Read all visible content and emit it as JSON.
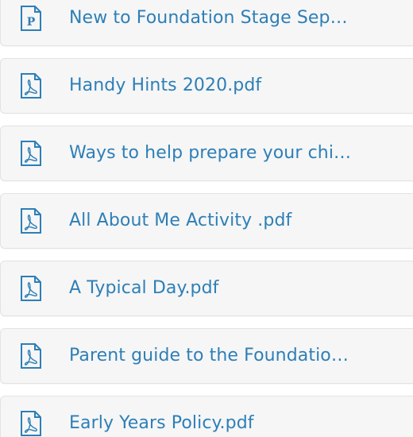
{
  "files": [
    {
      "name": "New to Foundation Stage Sep…",
      "icon": "publisher-file-icon"
    },
    {
      "name": "Handy Hints 2020.pdf",
      "icon": "pdf-file-icon"
    },
    {
      "name": "Ways to help prepare your chi…",
      "icon": "pdf-file-icon"
    },
    {
      "name": "All About Me Activity .pdf",
      "icon": "pdf-file-icon"
    },
    {
      "name": "A Typical Day.pdf",
      "icon": "pdf-file-icon"
    },
    {
      "name": "Parent guide to the Foundatio…",
      "icon": "pdf-file-icon"
    },
    {
      "name": "Early Years Policy.pdf",
      "icon": "pdf-file-icon"
    }
  ],
  "colors": {
    "link": "#2d7fb7",
    "icon": "#2d7fb7",
    "row_background": "#f6f6f6",
    "row_border": "#e3e3e3"
  }
}
